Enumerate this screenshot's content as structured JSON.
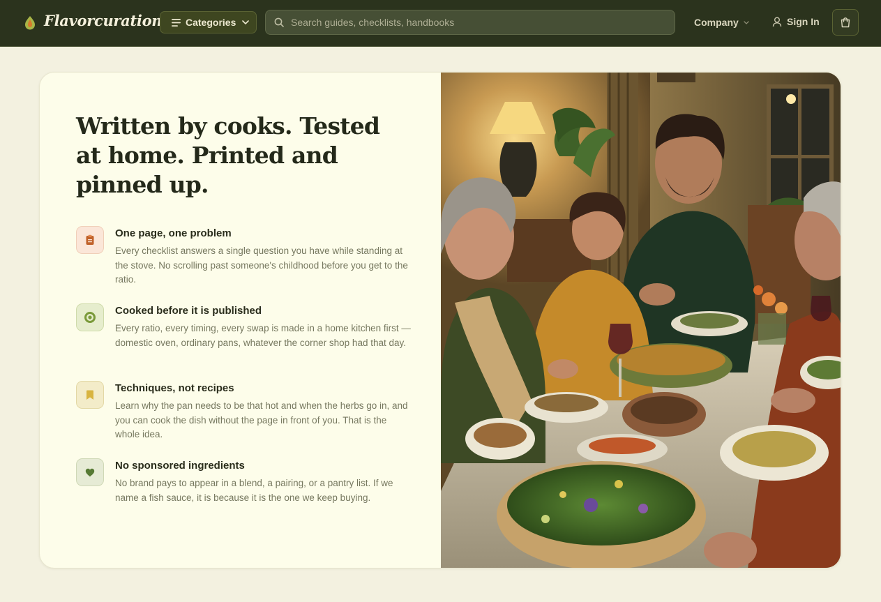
{
  "brand": {
    "name": "Flavorcuration",
    "icon": "leaf-drop-icon"
  },
  "nav": {
    "categories_label": "Categories",
    "search_placeholder": "Search guides, checklists, handbooks",
    "company_label": "Company",
    "signin_label": "Sign In",
    "cart_icon": "shopping-bag-icon"
  },
  "hero": {
    "headline": "Written by cooks. Tested at home. Printed and pinned up.",
    "features": [
      {
        "title": "One page, one problem",
        "description": "Every checklist answers a single question you have while standing at the stove. No scrolling past someone's childhood before you get to the ratio.",
        "icon": "clipboard-icon"
      },
      {
        "title": "Cooked before it is published",
        "description": "Every ratio, every timing, every swap is made in a home kitchen first — domestic oven, ordinary pans, whatever the corner shop had that day.",
        "icon": "target-icon"
      },
      {
        "title": "Techniques, not recipes",
        "description": "Learn why the pan needs to be that hot and when the herbs go in, and you can cook the dish without the page in front of you. That is the whole idea.",
        "icon": "bookmark-icon"
      },
      {
        "title": "No sponsored ingredients",
        "description": "No brand pays to appear in a blend, a pairing, or a pantry list. If we name a fish sauce, it is because it is the one we keep buying.",
        "icon": "heart-icon"
      }
    ]
  },
  "colors": {
    "nav_bg": "#2b331d",
    "page_bg": "#f3f1e0",
    "card_bg": "#fdfdea",
    "accent_green": "#7a9a3a",
    "accent_orange": "#c0622a",
    "accent_gold": "#d8b440"
  }
}
